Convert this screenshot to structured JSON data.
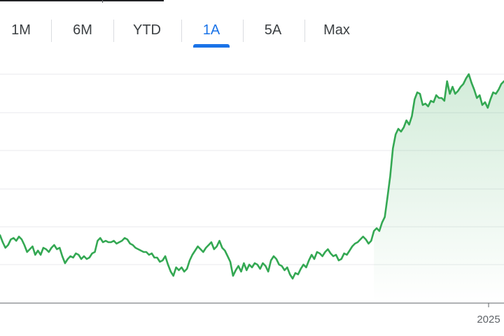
{
  "tabs": [
    {
      "label": "1M",
      "active": false
    },
    {
      "label": "6M",
      "active": false
    },
    {
      "label": "YTD",
      "active": false
    },
    {
      "label": "1A",
      "active": true
    },
    {
      "label": "5A",
      "active": false
    },
    {
      "label": "Max",
      "active": false
    }
  ],
  "colors": {
    "line": "#34a853",
    "fill": "#34a853",
    "grid": "#e8eaed",
    "axis": "#5f6368",
    "active_tab": "#1a73e8",
    "text": "#3c4043"
  },
  "chart_data": {
    "type": "area",
    "x_tick_labels": [
      "2025"
    ],
    "grid": true,
    "series": [
      {
        "values": [
          48,
          43,
          39,
          41,
          45,
          46,
          44,
          47,
          45,
          41,
          36,
          38,
          40,
          34,
          37,
          34,
          39,
          38,
          36,
          39,
          41,
          38,
          39,
          33,
          28,
          31,
          33,
          32,
          35,
          34,
          31,
          33,
          31,
          32,
          35,
          36,
          44,
          46,
          43,
          44,
          43,
          43,
          44,
          42,
          43,
          44,
          46,
          45,
          42,
          41,
          39,
          38,
          37,
          36,
          36,
          34,
          35,
          32,
          32,
          29,
          30,
          33,
          27,
          22,
          19,
          25,
          23,
          25,
          22,
          24,
          30,
          34,
          37,
          40,
          38,
          36,
          39,
          41,
          43,
          38,
          40,
          44,
          39,
          37,
          33,
          29,
          19,
          23,
          26,
          22,
          28,
          23,
          27,
          25,
          28,
          27,
          24,
          28,
          26,
          22,
          30,
          33,
          31,
          27,
          26,
          23,
          25,
          20,
          17,
          21,
          20,
          24,
          27,
          25,
          30,
          34,
          31,
          36,
          35,
          33,
          36,
          38,
          35,
          33,
          34,
          30,
          31,
          35,
          34,
          37,
          40,
          42,
          43,
          45,
          47,
          45,
          42,
          44,
          51,
          53,
          51,
          57,
          61,
          75,
          90,
          110,
          120,
          124,
          122,
          125,
          130,
          127,
          133,
          145,
          150,
          149,
          141,
          142,
          140,
          144,
          143,
          148,
          146,
          146,
          144,
          158,
          149,
          154,
          149,
          151,
          154,
          156,
          160,
          163,
          157,
          152,
          146,
          148,
          141,
          143,
          139,
          145,
          150,
          149,
          152,
          156,
          158
        ]
      }
    ]
  }
}
